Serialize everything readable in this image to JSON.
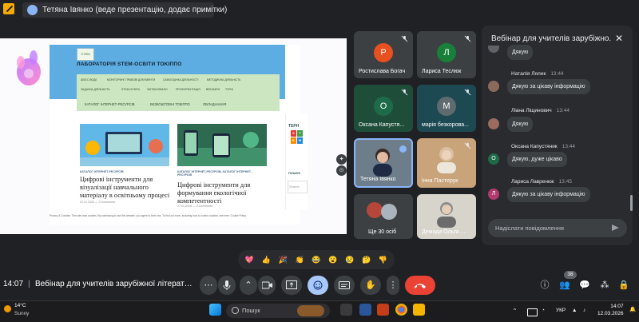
{
  "presenter_bar": {
    "text": "Тетяна Івянко (веде презентацію, додає примітки)"
  },
  "slide": {
    "site_logo_text": "СТЕМ",
    "site_title": "ЛАБОРАТОРІЯ STEM-ОСВІТИ TOKIППО",
    "nav_row1": [
      "АБІЄС ВОДІЇ",
      "МОНІТОРИНГ ПРАВОВІ ДОКУМЕНТИ",
      "САМООЦІНКА ДІЯЛЬНОСТІ",
      "МЕТОДИЧНА ДІЯЛЬНІСТЬ"
    ],
    "nav_row2": [
      "ЗАДАЧНА ДІЯЛЬНІСТЬ",
      "STEM-ОСВІТА",
      "ЗАПЛАНОВАНО",
      "ПРОФОРІЄНТАЦІЯ",
      "ВЕБІНАРИ",
      "ТУРНІ"
    ],
    "nav_row3": [
      "КАТАЛОГ ІНТЕРНЕТ-РЕСУРСІВ",
      "БЕЗКОШТОВНІ ТОКІППО",
      "ОБЛАДНАННЯ"
    ],
    "side_tag": "ТЕРН",
    "side_label": "ПОШУК",
    "search_placeholder": "Search",
    "cards": [
      {
        "category": "КАТАЛОГ ІНТЕРНЕТ-РЕСУРСІВ",
        "title": "Цифрові інструменти для візуалізації навчального матеріалу в освітньому процесі",
        "meta": "22.01.2026 — 0 Comments"
      },
      {
        "category": "КАТАЛОГ ІНТЕРНЕТ-РЕСУРСІВ, КАТАЛОГ ІНТЕРНЕТ-РЕСУРСІВ",
        "title": "Цифрові інструменти для формування екологічної компетентності",
        "meta": "27.01.2026 — 0 Comments"
      }
    ],
    "cookie_text": "Privacy & Cookies: This site uses cookies. By continuing to use this website, you agree to their use. To find out more, including how to control cookies, see here: Cookie Policy",
    "cube_letters": [
      "S",
      "T",
      "E",
      "M"
    ]
  },
  "participants": [
    {
      "name": "Ростислава Богач",
      "initial": "Р",
      "color": "#e8501f"
    },
    {
      "name": "Лариса Теслюк",
      "initial": "Л",
      "color": "#188038"
    },
    {
      "name": "Оксана Капустя...",
      "initial": "О",
      "color": "#1e6b4a"
    },
    {
      "name": "марія безкорова...",
      "initial": "М",
      "color": "#5f6b6e"
    },
    {
      "name": "Тетяна Івянко"
    },
    {
      "name": "Інна Пастерук"
    },
    {
      "name": "Ще 30 осіб"
    },
    {
      "name": "Демида Ольга ..."
    }
  ],
  "chat": {
    "title": "Вебінар для учителів зарубіжно...",
    "messages": [
      {
        "author": "",
        "time": "",
        "text": "Дякую",
        "avatar": ""
      },
      {
        "author": "Наталія Лялик",
        "time": "13:44",
        "text": "Дякую за цікаву інформацію",
        "avatar": ""
      },
      {
        "author": "Ліана Ліщинович",
        "time": "13:44",
        "text": "Дякую",
        "avatar": ""
      },
      {
        "author": "Оксана Капустяник",
        "time": "13:44",
        "text": "Дякую, дуже цікаво",
        "avatar": "О"
      },
      {
        "author": "Лариса Лавренюк",
        "time": "13:45",
        "text": "Дякую за цікаву інформацію",
        "avatar": "Л"
      }
    ],
    "input_placeholder": "Надіслати повідомлення"
  },
  "reactions": [
    "💖",
    "👍",
    "🎉",
    "👏",
    "😂",
    "😮",
    "😢",
    "🤔",
    "👎"
  ],
  "controls": {
    "time": "14:07",
    "meeting_title": "Вебінар для учителів зарубіжної літератури «І...",
    "participants_count": "38"
  },
  "taskbar": {
    "temperature": "14°C",
    "condition": "Sunny",
    "search": "Пошук",
    "lang": "УКР",
    "time": "14:07",
    "date": "12.03.2026"
  },
  "colors": {
    "background": "#202124",
    "end_call": "#ea4335",
    "active_button": "#a8c7fa",
    "accent": "#8ab4f8"
  }
}
